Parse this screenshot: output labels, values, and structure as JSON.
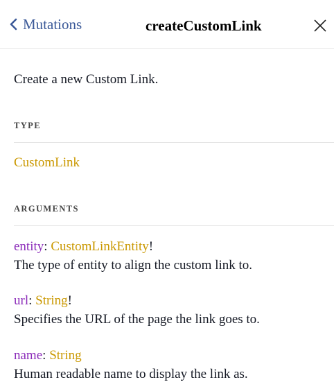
{
  "header": {
    "back_label": "Mutations",
    "title": "createCustomLink"
  },
  "description": "Create a new Custom Link.",
  "type_section": {
    "heading": "TYPE",
    "type_name": "CustomLink"
  },
  "arguments_section": {
    "heading": "ARGUMENTS",
    "args": [
      {
        "name": "entity",
        "colon": ": ",
        "type": "CustomLinkEntity",
        "required_mark": "!",
        "description": "The type of entity to align the custom link to."
      },
      {
        "name": "url",
        "colon": ": ",
        "type": "String",
        "required_mark": "!",
        "description": "Specifies the URL of the page the link goes to."
      },
      {
        "name": "name",
        "colon": ": ",
        "type": "String",
        "required_mark": "",
        "description": "Human readable name to display the link as."
      }
    ]
  },
  "colors": {
    "link_blue": "#3b5998",
    "type_gold": "#ca9800",
    "arg_purple": "#8b2bb9",
    "divider": "#e5e5e5"
  },
  "icons": {
    "back": "chevron-left-icon",
    "close": "close-icon"
  }
}
